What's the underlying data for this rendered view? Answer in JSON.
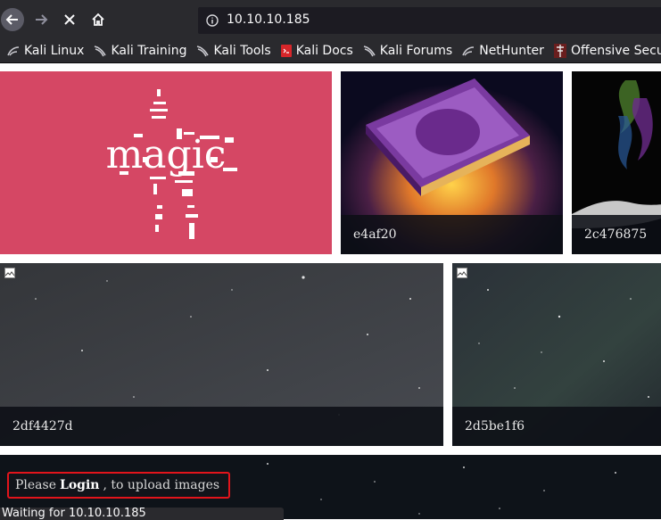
{
  "browser": {
    "url": "10.10.10.185",
    "status_text": "Waiting for 10.10.10.185",
    "bookmarks": [
      {
        "label": "Kali Linux",
        "icon": "kali-dragon-icon"
      },
      {
        "label": "Kali Training",
        "icon": "kali-dragon-icon"
      },
      {
        "label": "Kali Tools",
        "icon": "kali-dragon-icon"
      },
      {
        "label": "Kali Docs",
        "icon": "kali-docs-icon"
      },
      {
        "label": "Kali Forums",
        "icon": "kali-dragon-icon"
      },
      {
        "label": "NetHunter",
        "icon": "nethunter-icon"
      },
      {
        "label": "Offensive Security",
        "icon": "offsec-icon"
      }
    ]
  },
  "gallery": {
    "logo_text": "magic",
    "tiles": [
      {
        "caption": "e4af20"
      },
      {
        "caption": "2c476875"
      },
      {
        "caption": "2df4427d"
      },
      {
        "caption": "2d5be1f6"
      }
    ]
  },
  "notice": {
    "prefix": "Please",
    "link": "Login",
    "suffix": ", to upload images"
  },
  "colors": {
    "chrome": "#2a2a2e",
    "magic_tile": "#d54764",
    "notice_border": "#e2141b"
  }
}
